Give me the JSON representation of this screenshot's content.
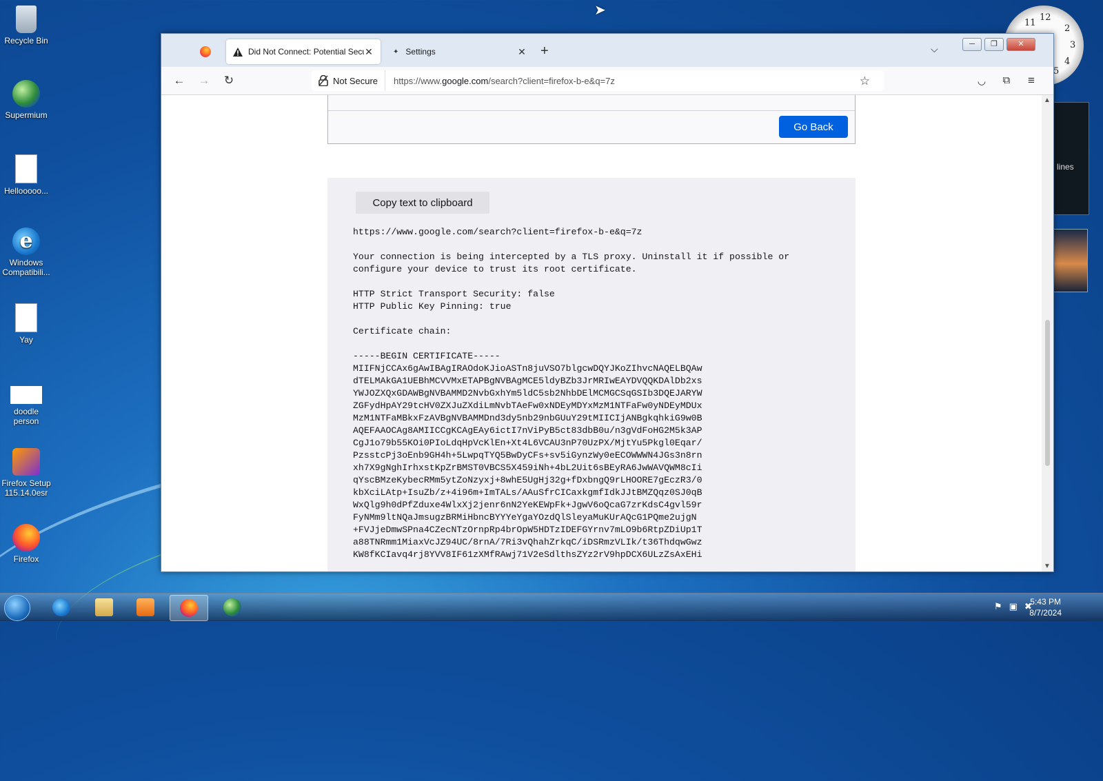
{
  "desktop": {
    "icons": [
      {
        "label": "Recycle Bin",
        "icon": "recycle-bin-icon"
      },
      {
        "label": "Supermium",
        "icon": "supermium-icon"
      },
      {
        "label": "Hellooooo...",
        "icon": "text-file-icon"
      },
      {
        "label": "Windows Compatibili...",
        "icon": "ie-icon"
      },
      {
        "label": "Yay",
        "icon": "text-file-icon"
      },
      {
        "label": "doodle person",
        "icon": "image-file-icon"
      },
      {
        "label": "Firefox Setup 115.14.0esr",
        "icon": "firefox-setup-icon"
      },
      {
        "label": "Firefox",
        "icon": "firefox-icon"
      }
    ],
    "gadget_text": "lines"
  },
  "browser": {
    "tabs": [
      {
        "label": "Did Not Connect: Potential Security Issue",
        "icon": "warning-icon",
        "active": true
      },
      {
        "label": "Settings",
        "icon": "settings-icon",
        "active": false
      }
    ],
    "nav": {
      "security_label": "Not Secure",
      "url_prefix": "https://www.",
      "url_domain": "google.com",
      "url_rest": "/search?client=firefox-b-e&q=7z"
    },
    "page": {
      "go_back_label": "Go Back",
      "copy_button_label": "Copy text to clipboard",
      "details": "https://www.google.com/search?client=firefox-b-e&q=7z\n\nYour connection is being intercepted by a TLS proxy. Uninstall it if possible or\nconfigure your device to trust its root certificate.\n\nHTTP Strict Transport Security: false\nHTTP Public Key Pinning: true\n\nCertificate chain:\n\n-----BEGIN CERTIFICATE-----\nMIIFNjCCAx6gAwIBAgIRAOdoKJioASTn8juVSO7blgcwDQYJKoZIhvcNAQELBQAw\ndTELMAkGA1UEBhMCVVMxETAPBgNVBAgMCE5ldyBZb3JrMRIwEAYDVQQKDAlDb2xs\nYWJOZXQxGDAWBgNVBAMMD2NvbGxhYm5ldC5sb2NhbDElMCMGCSqGSIb3DQEJARYW\nZGFydHpAY29tcHV0ZXJuZXdiLmNvbTAeFw0xNDEyMDYxMzM1NTFaFw0yNDEyMDUx\nMzM1NTFaMBkxFzAVBgNVBAMMDnd3dy5nb29nbGUuY29tMIICIjANBgkqhkiG9w0B\nAQEFAAOCAg8AMIICCgKCAgEAy6ictI7nViPyB5ct83dbB0u/n3gVdFoHG2M5k3AP\nCgJ1o79b55KOi0PIoLdqHpVcKlEn+Xt4L6VCAU3nP70UzPX/MjtYu5Pkgl0Eqar/\nPzsstcPj3oEnb9GH4h+5LwpqTYQ5BwDyCFs+sv5iGynzWy0eECOWWWN4JGs3n8rn\nxh7X9gNghIrhxstKpZrBMST0VBCS5X459iNh+4bL2Uit6sBEyRA6JwWAVQWM8cIi\nqYscBMzeKybecRMm5ytZoNzyxj+8whE5UgHj32g+fDxbngQ9rLHOORE7gEczR3/0\nkbXciLAtp+IsuZb/z+4i96m+ImTALs/AAuSfrCICaxkgmfIdkJJtBMZQqz0SJ0qB\nWxQlg9h0dPfZduxe4WlxXj2jenr6nN2YeKEWpFk+JgwV6oQcaG7zrKdsC4gvl59r\nFyNMm9ltNQaJmsugzBRMiHbncBYYYeYgaYOzdQlSleyaMuKUrAQcG1PQme2ujgN\n+FVJjeDmwSPna4CZecNTzOrnpRp4brOpW5HDTzIDEFGYrnv7mLO9b6RtpZDiUp1T\na88TNRmm1MiaxVcJZ94UC/8rnA/7Ri3vQhahZrkqC/iDSRmzVLIk/t36ThdqwGwz\nKW8fKCIavq4rj8YVV8IF61zXMfRAwj71V2eSdlthsZYz2rV9hpDCX6ULzZsAxEHi"
    }
  },
  "taskbar": {
    "items": [
      "ie-icon",
      "explorer-icon",
      "media-player-icon",
      "firefox-icon",
      "supermium-icon"
    ],
    "time": "5:43 PM",
    "date": "8/7/2024"
  }
}
